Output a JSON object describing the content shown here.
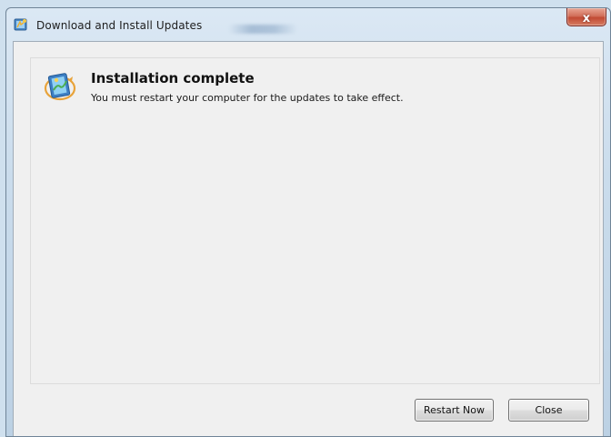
{
  "window": {
    "title": "Download and Install Updates",
    "close_glyph": "x"
  },
  "status": {
    "icon": "windows-update-icon",
    "heading": "Installation complete",
    "message": "You must restart your computer for the updates to take effect."
  },
  "buttons": {
    "restart_label": "Restart Now",
    "close_label": "Close"
  },
  "colors": {
    "close_button": "#c24a33",
    "titlebar": "#cadcec",
    "client_background": "#f0f0f0"
  }
}
